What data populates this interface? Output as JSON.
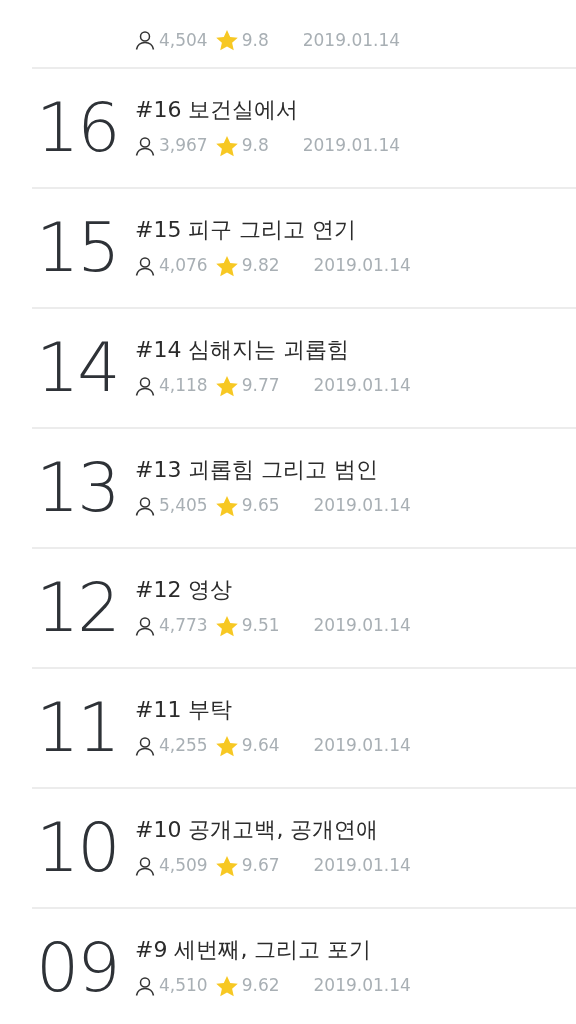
{
  "episodes": [
    {
      "views": "4,504",
      "rating": "9.8",
      "date": "2019.01.14"
    },
    {
      "number": "16",
      "title": "#16 보건실에서",
      "views": "3,967",
      "rating": "9.8",
      "date": "2019.01.14"
    },
    {
      "number": "15",
      "title": "#15 피구 그리고 연기",
      "views": "4,076",
      "rating": "9.82",
      "date": "2019.01.14"
    },
    {
      "number": "14",
      "title": "#14 심해지는 괴롭힘",
      "views": "4,118",
      "rating": "9.77",
      "date": "2019.01.14"
    },
    {
      "number": "13",
      "title": "#13 괴롭힘 그리고 범인",
      "views": "5,405",
      "rating": "9.65",
      "date": "2019.01.14"
    },
    {
      "number": "12",
      "title": "#12 영상",
      "views": "4,773",
      "rating": "9.51",
      "date": "2019.01.14"
    },
    {
      "number": "11",
      "title": "#11 부탁",
      "views": "4,255",
      "rating": "9.64",
      "date": "2019.01.14"
    },
    {
      "number": "10",
      "title": "#10 공개고백, 공개연애",
      "views": "4,509",
      "rating": "9.67",
      "date": "2019.01.14"
    },
    {
      "number": "09",
      "title": "#9 세번째, 그리고 포기",
      "views": "4,510",
      "rating": "9.62",
      "date": "2019.01.14"
    }
  ]
}
